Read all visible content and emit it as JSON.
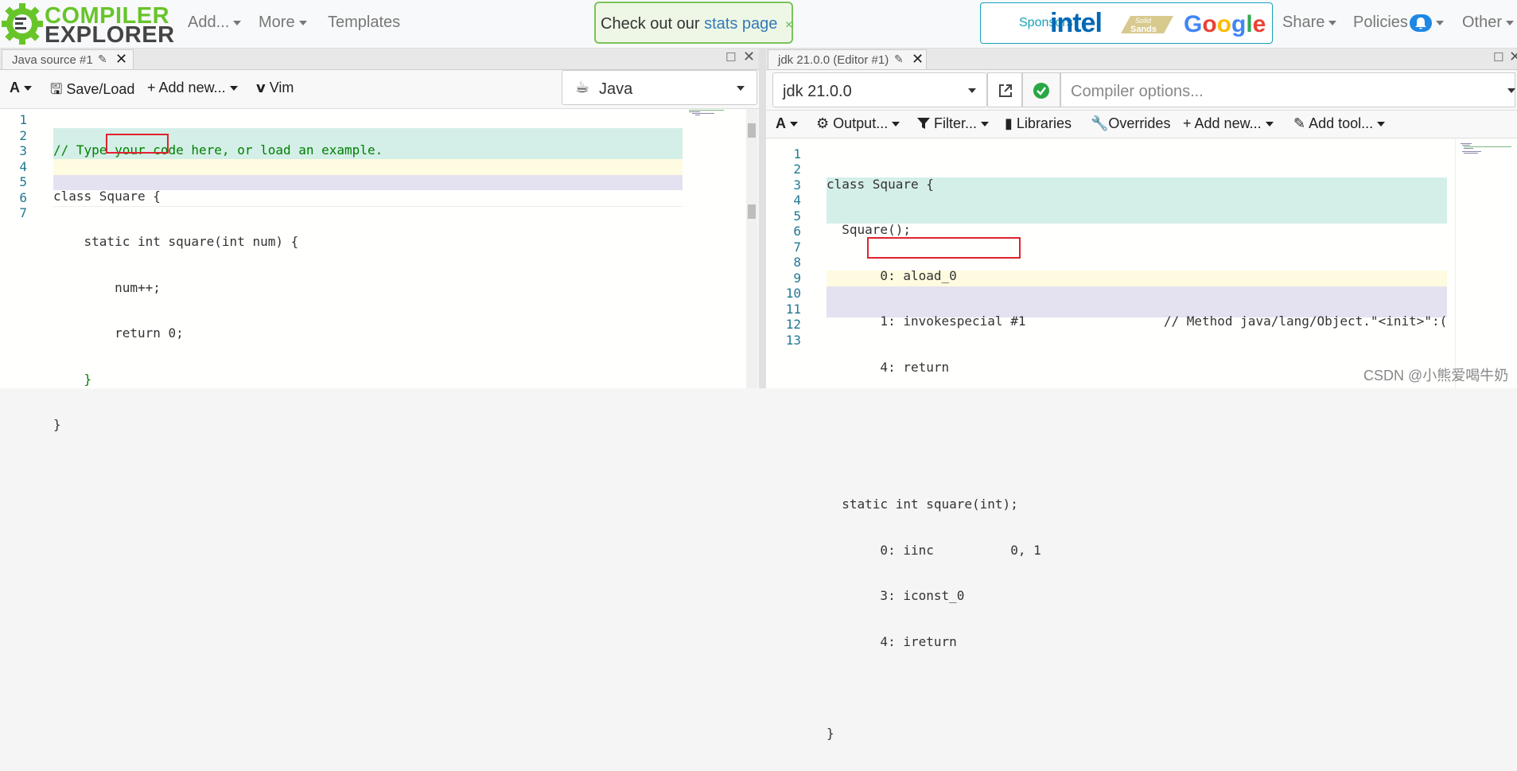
{
  "nav": {
    "logo_line1": "COMPILER",
    "logo_line2": "EXPLORER",
    "add_label": "Add...",
    "more_label": "More",
    "templates_label": "Templates",
    "alert_prefix": "Check out our",
    "alert_link": "stats page",
    "alert_close": "×",
    "sponsors_label": "Sponsors",
    "sponsor_intel": "intel",
    "sponsor_solid": "Solid Sands",
    "share_label": "Share",
    "policies_label": "Policies",
    "other_label": "Other"
  },
  "source_pane": {
    "tab_title": "Java source #1",
    "font_btn": "A",
    "save_load": "Save/Load",
    "add_new": "Add new...",
    "vim": "Vim",
    "language": "Java",
    "line_numbers": [
      "1",
      "2",
      "3",
      "4",
      "5",
      "6",
      "7"
    ],
    "lines": [
      "// Type your code here, or load an example.",
      "class Square {",
      "    static int square(int num) {",
      "        num++;",
      "        return 0;",
      "    }",
      "}"
    ]
  },
  "compiler_pane": {
    "tab_title": "jdk 21.0.0 (Editor #1)",
    "compiler_name": "jdk 21.0.0",
    "options_placeholder": "Compiler options...",
    "font_btn": "A",
    "output_btn": "Output...",
    "filter_btn": "Filter...",
    "libraries_btn": "Libraries",
    "overrides_btn": "Overrides",
    "add_new_btn": "Add new...",
    "add_tool_btn": "Add tool...",
    "line_numbers": [
      "1",
      "2",
      "3",
      "4",
      "5",
      "6",
      "7",
      "8",
      "9",
      "10",
      "11",
      "12",
      "13"
    ],
    "lines": [
      "class Square {",
      "  Square();",
      "       0: aload_0",
      "       1: invokespecial #1                  // Method java/lang/Object.\"<init>\":(",
      "       4: return",
      "",
      "",
      "  static int square(int);",
      "       0: iinc          0, 1",
      "       3: iconst_0",
      "       4: ireturn",
      "",
      "}"
    ]
  },
  "colors": {
    "accent_green": "#67c52a",
    "highlight_teal": "#d4efe8",
    "highlight_yellow": "#fffbe0",
    "highlight_lavender": "#e4e2f0",
    "redbox": "#e0232e"
  },
  "watermark": "CSDN @小熊爱喝牛奶"
}
